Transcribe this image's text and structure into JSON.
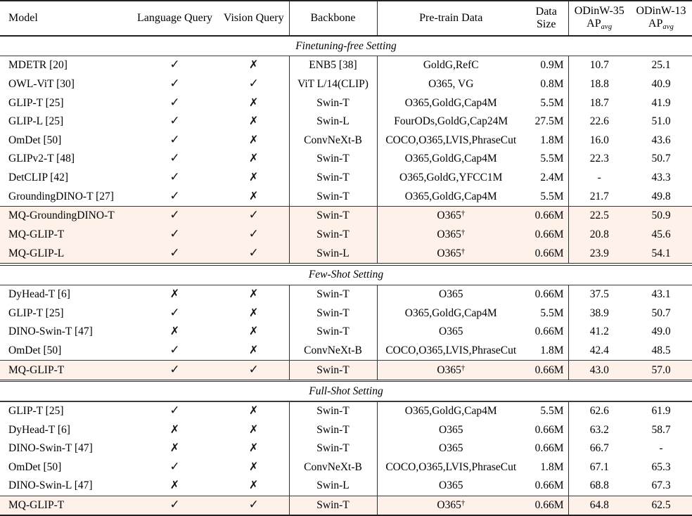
{
  "table": {
    "columns": [
      {
        "key": "model",
        "label": "Model"
      },
      {
        "key": "lang",
        "label": "Language Query"
      },
      {
        "key": "vis",
        "label": "Vision Query"
      },
      {
        "key": "backbone",
        "label": "Backbone"
      },
      {
        "key": "pretrain",
        "label": "Pre-train Data"
      },
      {
        "key": "size",
        "label_line1": "Data",
        "label_line2": "Size"
      },
      {
        "key": "odinw35",
        "label_line1": "ODinW-35",
        "label_line2": "AP",
        "label_sub": "avg"
      },
      {
        "key": "odinw13",
        "label_line1": "ODinW-13",
        "label_line2": "AP",
        "label_sub": "avg"
      }
    ],
    "marks": {
      "check": "✓",
      "cross": "✗",
      "dagger": "†",
      "missing": "-"
    },
    "highlight_color": "#fdf1e9",
    "sections": [
      {
        "label": "Finetuning-free Setting",
        "rows": [
          {
            "model": "MDETR [20]",
            "lang": "check",
            "vis": "cross",
            "backbone": "ENB5 [38]",
            "pretrain": "GoldG,RefC",
            "dagger": false,
            "size": "0.9M",
            "odinw35": "10.7",
            "odinw13": "25.1",
            "bold35": false,
            "bold13": false,
            "highlight": false
          },
          {
            "model": "OWL-ViT [30]",
            "lang": "check",
            "vis": "check",
            "backbone": "ViT L/14(CLIP)",
            "pretrain": "O365, VG",
            "dagger": false,
            "size": "0.8M",
            "odinw35": "18.8",
            "odinw13": "40.9",
            "bold35": false,
            "bold13": false,
            "highlight": false
          },
          {
            "model": "GLIP-T [25]",
            "lang": "check",
            "vis": "cross",
            "backbone": "Swin-T",
            "pretrain": "O365,GoldG,Cap4M",
            "dagger": false,
            "size": "5.5M",
            "odinw35": "18.7",
            "odinw13": "41.9",
            "bold35": false,
            "bold13": false,
            "highlight": false
          },
          {
            "model": "GLIP-L [25]",
            "lang": "check",
            "vis": "cross",
            "backbone": "Swin-L",
            "pretrain": "FourODs,GoldG,Cap24M",
            "dagger": false,
            "size": "27.5M",
            "odinw35": "22.6",
            "odinw13": "51.0",
            "bold35": false,
            "bold13": false,
            "highlight": false
          },
          {
            "model": "OmDet [50]",
            "lang": "check",
            "vis": "cross",
            "backbone": "ConvNeXt-B",
            "pretrain": "COCO,O365,LVIS,PhraseCut",
            "dagger": false,
            "size": "1.8M",
            "odinw35": "16.0",
            "odinw13": "43.6",
            "bold35": false,
            "bold13": false,
            "highlight": false
          },
          {
            "model": "GLIPv2-T [48]",
            "lang": "check",
            "vis": "cross",
            "backbone": "Swin-T",
            "pretrain": "O365,GoldG,Cap4M",
            "dagger": false,
            "size": "5.5M",
            "odinw35": "22.3",
            "odinw13": "50.7",
            "bold35": false,
            "bold13": false,
            "highlight": false
          },
          {
            "model": "DetCLIP [42]",
            "lang": "check",
            "vis": "cross",
            "backbone": "Swin-T",
            "pretrain": "O365,GoldG,YFCC1M",
            "dagger": false,
            "size": "2.4M",
            "odinw35": "-",
            "odinw13": "43.3",
            "bold35": false,
            "bold13": false,
            "highlight": false
          },
          {
            "model": "GroundingDINO-T [27]",
            "lang": "check",
            "vis": "cross",
            "backbone": "Swin-T",
            "pretrain": "O365,GoldG,Cap4M",
            "dagger": false,
            "size": "5.5M",
            "odinw35": "21.7",
            "odinw13": "49.8",
            "bold35": false,
            "bold13": false,
            "highlight": false
          },
          {
            "model": "MQ-GroundingDINO-T",
            "lang": "check",
            "vis": "check",
            "backbone": "Swin-T",
            "pretrain": "O365",
            "dagger": true,
            "size": "0.66M",
            "odinw35": "22.5",
            "odinw13": "50.9",
            "bold35": false,
            "bold13": false,
            "highlight": true
          },
          {
            "model": "MQ-GLIP-T",
            "lang": "check",
            "vis": "check",
            "backbone": "Swin-T",
            "pretrain": "O365",
            "dagger": true,
            "size": "0.66M",
            "odinw35": "20.8",
            "odinw13": "45.6",
            "bold35": false,
            "bold13": false,
            "highlight": true
          },
          {
            "model": "MQ-GLIP-L",
            "lang": "check",
            "vis": "check",
            "backbone": "Swin-L",
            "pretrain": "O365",
            "dagger": true,
            "size": "0.66M",
            "odinw35": "23.9",
            "odinw13": "54.1",
            "bold35": true,
            "bold13": true,
            "highlight": true
          }
        ],
        "group_break_after": 7
      },
      {
        "label": "Few-Shot Setting",
        "rows": [
          {
            "model": "DyHead-T [6]",
            "lang": "cross",
            "vis": "cross",
            "backbone": "Swin-T",
            "pretrain": "O365",
            "dagger": false,
            "size": "0.66M",
            "odinw35": "37.5",
            "odinw13": "43.1",
            "bold35": false,
            "bold13": false,
            "highlight": false
          },
          {
            "model": "GLIP-T [25]",
            "lang": "check",
            "vis": "cross",
            "backbone": "Swin-T",
            "pretrain": "O365,GoldG,Cap4M",
            "dagger": false,
            "size": "5.5M",
            "odinw35": "38.9",
            "odinw13": "50.7",
            "bold35": false,
            "bold13": false,
            "highlight": false
          },
          {
            "model": "DINO-Swin-T [47]",
            "lang": "cross",
            "vis": "cross",
            "backbone": "Swin-T",
            "pretrain": "O365",
            "dagger": false,
            "size": "0.66M",
            "odinw35": "41.2",
            "odinw13": "49.0",
            "bold35": false,
            "bold13": false,
            "highlight": false
          },
          {
            "model": "OmDet [50]",
            "lang": "check",
            "vis": "cross",
            "backbone": "ConvNeXt-B",
            "pretrain": "COCO,O365,LVIS,PhraseCut",
            "dagger": false,
            "size": "1.8M",
            "odinw35": "42.4",
            "odinw13": "48.5",
            "bold35": false,
            "bold13": false,
            "highlight": false
          },
          {
            "model": "MQ-GLIP-T",
            "lang": "check",
            "vis": "check",
            "backbone": "Swin-T",
            "pretrain": "O365",
            "dagger": true,
            "size": "0.66M",
            "odinw35": "43.0",
            "odinw13": "57.0",
            "bold35": true,
            "bold13": true,
            "highlight": true
          }
        ],
        "group_break_after": 3
      },
      {
        "label": "Full-Shot Setting",
        "rows": [
          {
            "model": "GLIP-T [25]",
            "lang": "check",
            "vis": "cross",
            "backbone": "Swin-T",
            "pretrain": "O365,GoldG,Cap4M",
            "dagger": false,
            "size": "5.5M",
            "odinw35": "62.6",
            "odinw13": "61.9",
            "bold35": false,
            "bold13": false,
            "highlight": false
          },
          {
            "model": "DyHead-T [6]",
            "lang": "cross",
            "vis": "cross",
            "backbone": "Swin-T",
            "pretrain": "O365",
            "dagger": false,
            "size": "0.66M",
            "odinw35": "63.2",
            "odinw13": "58.7",
            "bold35": false,
            "bold13": false,
            "highlight": false
          },
          {
            "model": "DINO-Swin-T [47]",
            "lang": "cross",
            "vis": "cross",
            "backbone": "Swin-T",
            "pretrain": "O365",
            "dagger": false,
            "size": "0.66M",
            "odinw35": "66.7",
            "odinw13": "-",
            "bold35": false,
            "bold13": false,
            "highlight": false
          },
          {
            "model": "OmDet [50]",
            "lang": "check",
            "vis": "cross",
            "backbone": "ConvNeXt-B",
            "pretrain": "COCO,O365,LVIS,PhraseCut",
            "dagger": false,
            "size": "1.8M",
            "odinw35": "67.1",
            "odinw13": "65.3",
            "bold35": false,
            "bold13": false,
            "highlight": false
          },
          {
            "model": "DINO-Swin-L [47]",
            "lang": "cross",
            "vis": "cross",
            "backbone": "Swin-L",
            "pretrain": "O365",
            "dagger": false,
            "size": "0.66M",
            "odinw35": "68.8",
            "odinw13": "67.3",
            "bold35": false,
            "bold13": false,
            "highlight": false
          },
          {
            "model": "MQ-GLIP-T",
            "lang": "check",
            "vis": "check",
            "backbone": "Swin-T",
            "pretrain": "O365",
            "dagger": true,
            "size": "0.66M",
            "odinw35": "64.8",
            "odinw13": "62.5",
            "bold35": false,
            "bold13": false,
            "highlight": true
          }
        ],
        "group_break_after": 4
      }
    ]
  }
}
